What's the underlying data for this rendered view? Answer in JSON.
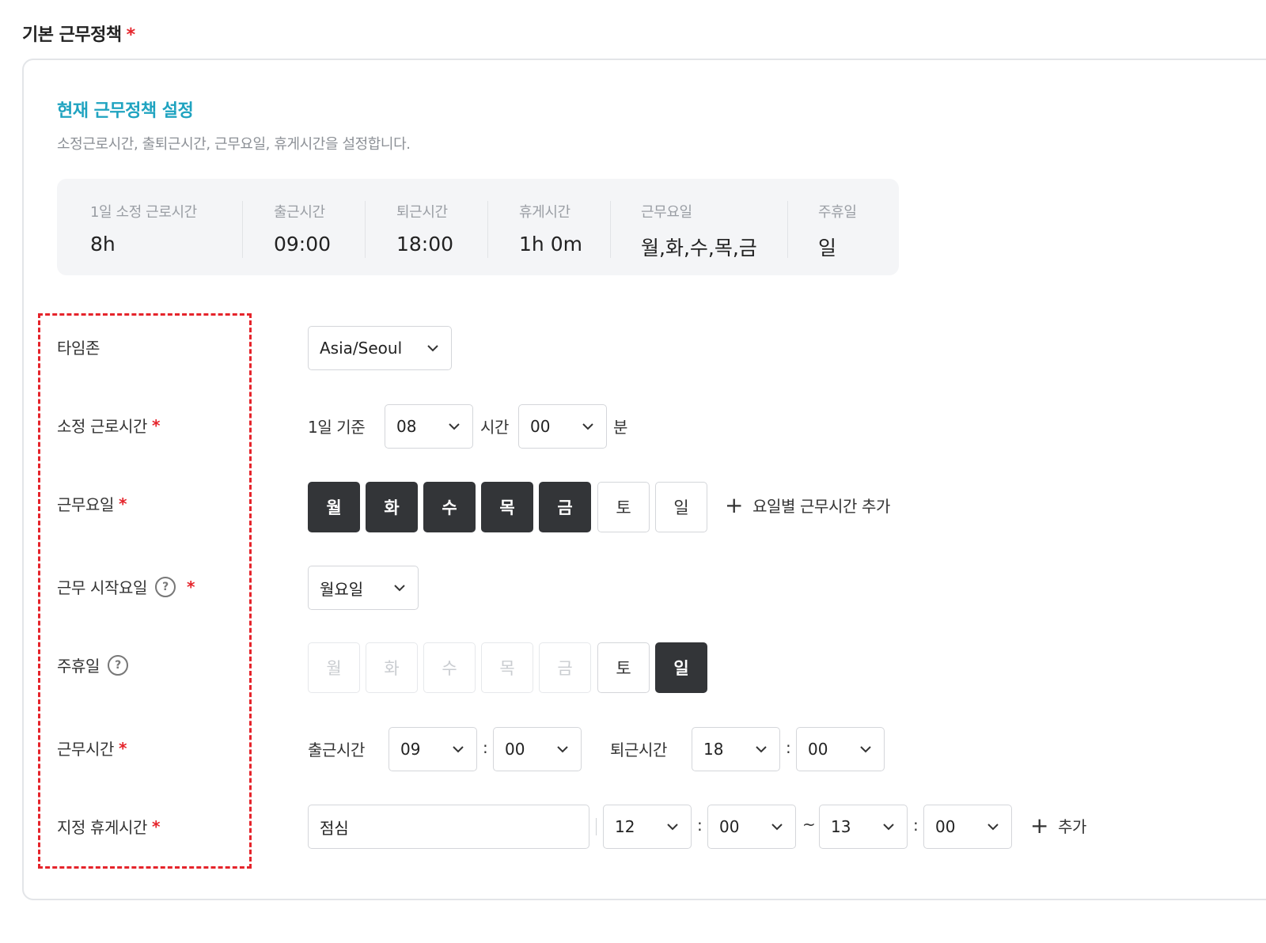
{
  "section": {
    "title": "기본 근무정책",
    "required_mark": "*"
  },
  "current": {
    "title": "현재 근무정책 설정",
    "description": "소정근로시간, 출퇴근시간, 근무요일, 휴게시간을 설정합니다.",
    "summary": [
      {
        "label": "1일 소정 근로시간",
        "value": "8h"
      },
      {
        "label": "출근시간",
        "value": "09:00"
      },
      {
        "label": "퇴근시간",
        "value": "18:00"
      },
      {
        "label": "휴게시간",
        "value": "1h 0m"
      },
      {
        "label": "근무요일",
        "value": "월,화,수,목,금"
      },
      {
        "label": "주휴일",
        "value": "일"
      }
    ]
  },
  "form": {
    "timezone": {
      "label": "타임존",
      "value": "Asia/Seoul"
    },
    "work_hours": {
      "label": "소정 근로시간",
      "required": "*",
      "prefix": "1일 기준",
      "hours": "08",
      "hours_unit": "시간",
      "minutes": "00",
      "minutes_unit": "분"
    },
    "work_days": {
      "label": "근무요일",
      "required": "*",
      "days": [
        {
          "label": "월",
          "state": "on"
        },
        {
          "label": "화",
          "state": "on"
        },
        {
          "label": "수",
          "state": "on"
        },
        {
          "label": "목",
          "state": "on"
        },
        {
          "label": "금",
          "state": "on"
        },
        {
          "label": "토",
          "state": "off"
        },
        {
          "label": "일",
          "state": "off"
        }
      ],
      "add_label": "요일별 근무시간 추가"
    },
    "start_day": {
      "label": "근무 시작요일",
      "help": "?",
      "required": "*",
      "value": "월요일"
    },
    "weekly_holiday": {
      "label": "주휴일",
      "help": "?",
      "days": [
        {
          "label": "월",
          "state": "dis"
        },
        {
          "label": "화",
          "state": "dis"
        },
        {
          "label": "수",
          "state": "dis"
        },
        {
          "label": "목",
          "state": "dis"
        },
        {
          "label": "금",
          "state": "dis"
        },
        {
          "label": "토",
          "state": "off"
        },
        {
          "label": "일",
          "state": "on"
        }
      ]
    },
    "work_time": {
      "label": "근무시간",
      "required": "*",
      "start_label": "출근시간",
      "start_hour": "09",
      "start_minute": "00",
      "end_label": "퇴근시간",
      "end_hour": "18",
      "end_minute": "00",
      "colon": ":"
    },
    "break_time": {
      "label": "지정 휴게시간",
      "required": "*",
      "name": "점심",
      "from_hour": "12",
      "from_minute": "00",
      "tilde": "~",
      "to_hour": "13",
      "to_minute": "00",
      "colon": ":",
      "add_label": "추가"
    }
  }
}
